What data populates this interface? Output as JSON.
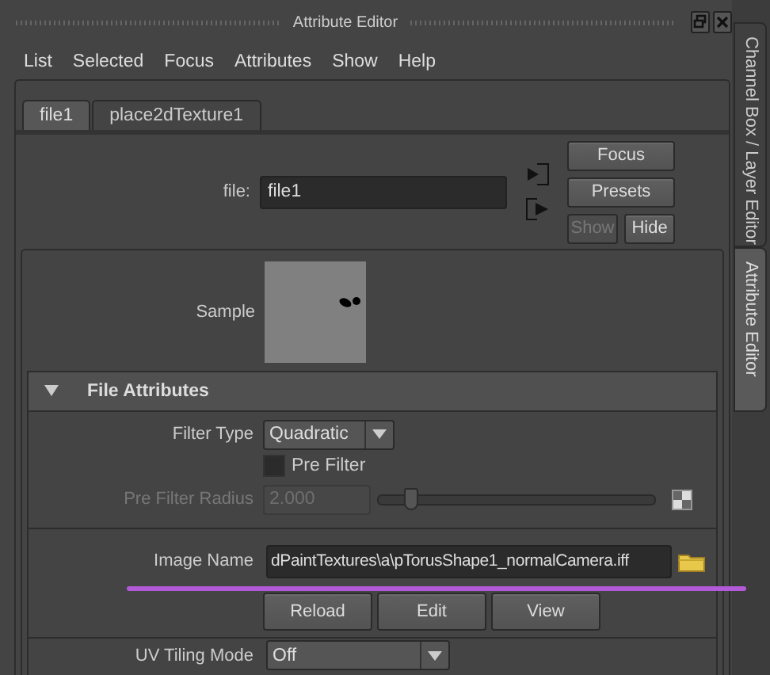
{
  "window": {
    "title": "Attribute Editor"
  },
  "menu": [
    "List",
    "Selected",
    "Focus",
    "Attributes",
    "Show",
    "Help"
  ],
  "tabs": [
    {
      "label": "file1",
      "selected": true
    },
    {
      "label": "place2dTexture1",
      "selected": false
    }
  ],
  "node": {
    "label": "file:",
    "value": "file1"
  },
  "side_buttons": [
    {
      "label": "Focus",
      "disabled": false
    },
    {
      "label": "Presets",
      "disabled": false
    }
  ],
  "show_hide": [
    {
      "label": "Show",
      "disabled": true
    },
    {
      "label": "Hide",
      "disabled": false
    }
  ],
  "sample": {
    "label": "Sample"
  },
  "section": {
    "title": "File Attributes",
    "expanded": true
  },
  "filter_type": {
    "label": "Filter Type",
    "value": "Quadratic"
  },
  "pre_filter": {
    "label": "Pre Filter",
    "checked": false
  },
  "pre_filter_radius": {
    "label": "Pre Filter Radius",
    "value": "2.000",
    "disabled": true,
    "level": 0.12
  },
  "image_name": {
    "label": "Image Name",
    "value": "dPaintTextures\\a\\pTorusShape1_normalCamera.iff"
  },
  "image_buttons": [
    "Reload",
    "Edit",
    "View"
  ],
  "uv_tiling": {
    "label": "UV Tiling Mode",
    "value": "Off"
  },
  "dock_tabs": [
    {
      "label": "Channel Box / Layer Editor",
      "selected": false
    },
    {
      "label": "Attribute Editor",
      "selected": true
    }
  ]
}
